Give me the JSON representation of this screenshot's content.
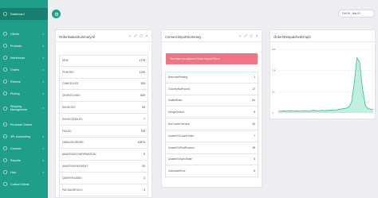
{
  "sidebar": {
    "items": [
      {
        "label": "Dashboard",
        "icon": "dashboard-icon",
        "active": true,
        "has_submenu": false
      },
      {
        "label": "Clients",
        "icon": "clients-icon",
        "active": false,
        "has_submenu": true
      },
      {
        "label": "Products",
        "icon": "products-icon",
        "active": false,
        "has_submenu": true
      },
      {
        "label": "Warehouse",
        "icon": "warehouse-icon",
        "active": false,
        "has_submenu": true
      },
      {
        "label": "Orders",
        "icon": "orders-icon",
        "active": false,
        "has_submenu": true
      },
      {
        "label": "Returns",
        "icon": "returns-icon",
        "active": false,
        "has_submenu": true
      },
      {
        "label": "Picking",
        "icon": "picking-icon",
        "active": false,
        "has_submenu": true
      },
      {
        "label": "Shipping Management",
        "icon": "shipping-icon",
        "active": false,
        "has_submenu": true
      },
      {
        "label": "Purchase Orders",
        "icon": "purchase-orders-icon",
        "active": false,
        "has_submenu": false
      },
      {
        "label": "3PL Accounting",
        "icon": "accounting-icon",
        "active": false,
        "has_submenu": true
      },
      {
        "label": "Connect",
        "icon": "connect-icon",
        "active": false,
        "has_submenu": true
      },
      {
        "label": "Reports",
        "icon": "reports-icon",
        "active": false,
        "has_submenu": true
      },
      {
        "label": "Help",
        "icon": "help-icon",
        "active": false,
        "has_submenu": true
      },
      {
        "label": "Custom Extras",
        "icon": "custom-extras-icon",
        "active": false,
        "has_submenu": false
      }
    ]
  },
  "header": {
    "date_range": "Feb 26 - Mar 02"
  },
  "cards": {
    "order_status": {
      "title": "OrderStatusSummaryAll",
      "rows": [
        {
          "label": "NEW",
          "value": "1779"
        },
        {
          "label": "PRINTED",
          "value": "1120"
        },
        {
          "label": "CANCELLED",
          "value": "153"
        },
        {
          "label": "DESPATCHED",
          "value": "829"
        },
        {
          "label": "INVOICED",
          "value": "93"
        },
        {
          "label": "INVOICEFAILED",
          "value": "7"
        },
        {
          "label": "FAILED",
          "value": "729"
        },
        {
          "label": "ONBACKORDER",
          "value": "10873"
        },
        {
          "label": "AWAITINGCONFIRMATION",
          "value": "9"
        },
        {
          "label": "AWAITINGPAYMENT",
          "value": "20"
        },
        {
          "label": "QUERYRAISED",
          "value": "2"
        },
        {
          "label": "PACKAGEHOLD",
          "value": "3"
        }
      ]
    },
    "connect_import": {
      "title": "ConnectImportSummary",
      "alert": "You have un-actioned Order Import Errors",
      "rows": [
        {
          "label": "BarcodePrinting",
          "value": "1"
        },
        {
          "label": "CountryNotFound",
          "value": "17"
        },
        {
          "label": "InvalidData",
          "value": "61"
        },
        {
          "label": "MergeOrders",
          "value": "5"
        },
        {
          "label": "NoCourierService",
          "value": "42"
        },
        {
          "label": "UnableToCountOrder",
          "value": "7"
        },
        {
          "label": "UnableToFindProduct",
          "value": "19"
        },
        {
          "label": "UnableToSyncState",
          "value": "3"
        },
        {
          "label": "UnknownError",
          "value": "5"
        }
      ]
    },
    "orders_graph": {
      "title": "OrdersDespatchedGraph"
    }
  },
  "chart_data": {
    "type": "area",
    "title": "OrdersDespatchedGraph",
    "yticks": [
      "150",
      "100",
      "50",
      "0"
    ],
    "ylim": [
      0,
      150
    ],
    "xlabel": "",
    "ylabel": "",
    "grid": true,
    "legend": "none",
    "series": [
      {
        "values": [
          4,
          4,
          5,
          4,
          5,
          5,
          4,
          5,
          4,
          5,
          5,
          4,
          5,
          6,
          5,
          5,
          6,
          5,
          6,
          6,
          7,
          6,
          8,
          9,
          10,
          11,
          14,
          25,
          70,
          130,
          120,
          60,
          20,
          10,
          9,
          8
        ]
      }
    ],
    "color": "#2bbf9c"
  },
  "colors": {
    "sidebar": "#1f9e89",
    "accent": "#1f9e89",
    "alert": "#ef7486",
    "background": "#eceef1"
  }
}
